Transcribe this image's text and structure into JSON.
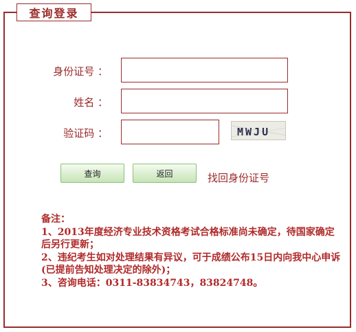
{
  "legend": {
    "title": "查询登录"
  },
  "form": {
    "id_label": "身份证号 ：",
    "name_label": "姓名 ：",
    "captcha_label": "验证码 ：",
    "id_value": "",
    "name_value": "",
    "captcha_value": "",
    "captcha_text": "MWJU"
  },
  "buttons": {
    "query_label": "查询",
    "back_label": "返回",
    "recover_link": "找回身份证号"
  },
  "notes": {
    "heading": "备注：",
    "lines": [
      "1、2013年度经济专业技术资格考试合格标准尚未确定，待国家确定后另行更新；",
      "2、违纪考生如对处理结果有异议，可于成绩公布15日内向我中心申诉(已提前告知处理决定的除外)；",
      "3、咨询电话：0311-83834743，83824748。"
    ]
  },
  "colors": {
    "accent": "#9a2a2a",
    "note_text": "#b02a2a",
    "button_green": "#c6e4b6"
  }
}
